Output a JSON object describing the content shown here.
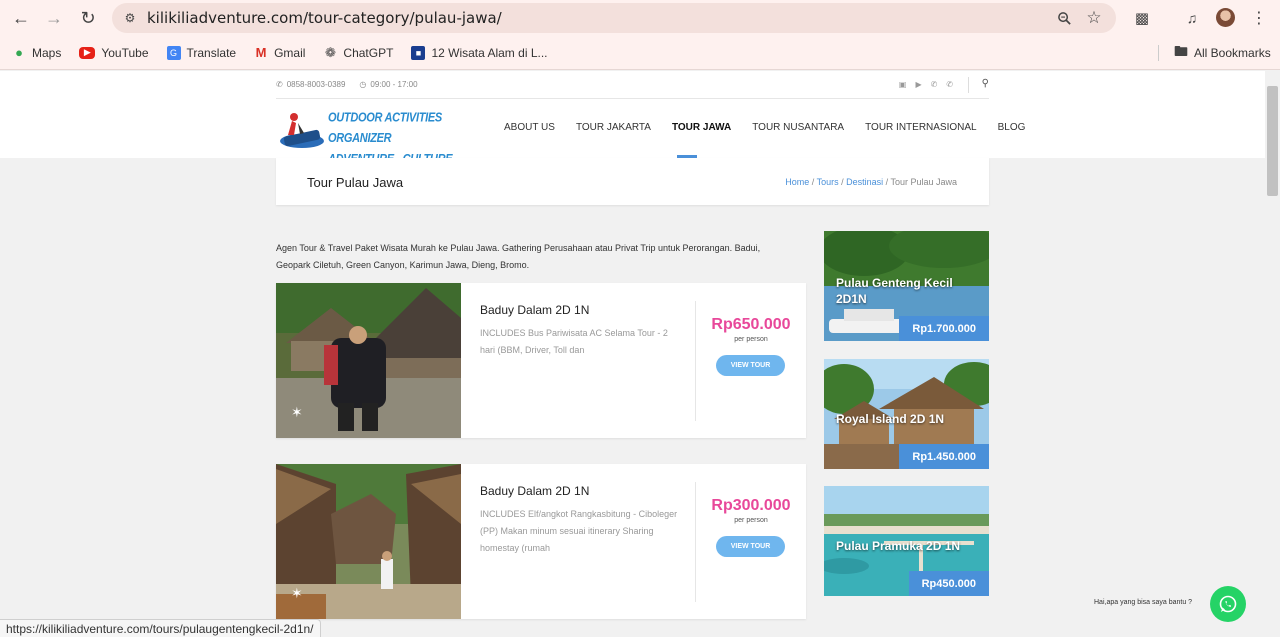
{
  "browser": {
    "url": "kilikiliadventure.com/tour-category/pulau-jawa/",
    "bookmarks": [
      "Maps",
      "YouTube",
      "Translate",
      "Gmail",
      "ChatGPT",
      "12 Wisata Alam di L..."
    ],
    "all_bookmarks": "All Bookmarks",
    "status_url": "https://kilikiliadventure.com/tours/pulaugentengkecil-2d1n/"
  },
  "topbar": {
    "phone": "0858-8003-0389",
    "hours": "09:00 - 17:00"
  },
  "logo": {
    "line1": "OUTDOOR ACTIVITIES ORGANIZER",
    "line2": "ADVENTURE - CULTURE - NATURE"
  },
  "nav": {
    "items": [
      "ABOUT US",
      "TOUR JAKARTA",
      "TOUR JAWA",
      "TOUR NUSANTARA",
      "TOUR INTERNASIONAL",
      "BLOG"
    ],
    "active": "TOUR JAWA"
  },
  "page": {
    "title": "Tour Pulau Jawa",
    "breadcrumb": {
      "home": "Home",
      "tours": "Tours",
      "destinasi": "Destinasi",
      "current": "Tour Pulau Jawa",
      "sep": " / "
    },
    "intro": "Agen Tour & Travel Paket Wisata Murah ke Pulau Jawa. Gathering Perusahaan atau Privat Trip untuk Perorangan. Badui, Geopark Ciletuh, Green Canyon, Karimun Jawa, Dieng, Bromo."
  },
  "tours": [
    {
      "name": "Baduy Dalam 2D 1N",
      "desc": "INCLUDES Bus Pariwisata AC Selama Tour - 2 hari (BBM, Driver, Toll dan",
      "price": "Rp650.000",
      "per": "per person",
      "button": "VIEW TOUR"
    },
    {
      "name": "Baduy Dalam 2D 1N",
      "desc": "INCLUDES Elf/angkot Rangkasbitung - Ciboleger (PP) Makan minum sesuai itinerary Sharing homestay (rumah",
      "price": "Rp300.000",
      "per": "per person",
      "button": "VIEW TOUR"
    }
  ],
  "sidebar": [
    {
      "name": "Pulau Genteng Kecil 2D1N",
      "price": "Rp1.700.000"
    },
    {
      "name": "Royal Island 2D 1N",
      "price": "Rp1.450.000"
    },
    {
      "name": "Pulau Pramuka 2D 1N",
      "price": "Rp450.000"
    }
  ],
  "whatsapp": {
    "text": "Hai,apa yang bisa saya bantu ?"
  },
  "colors": {
    "accent": "#4a90d9",
    "price": "#e8489a",
    "button": "#6fb6ee",
    "whatsapp": "#25d366"
  }
}
